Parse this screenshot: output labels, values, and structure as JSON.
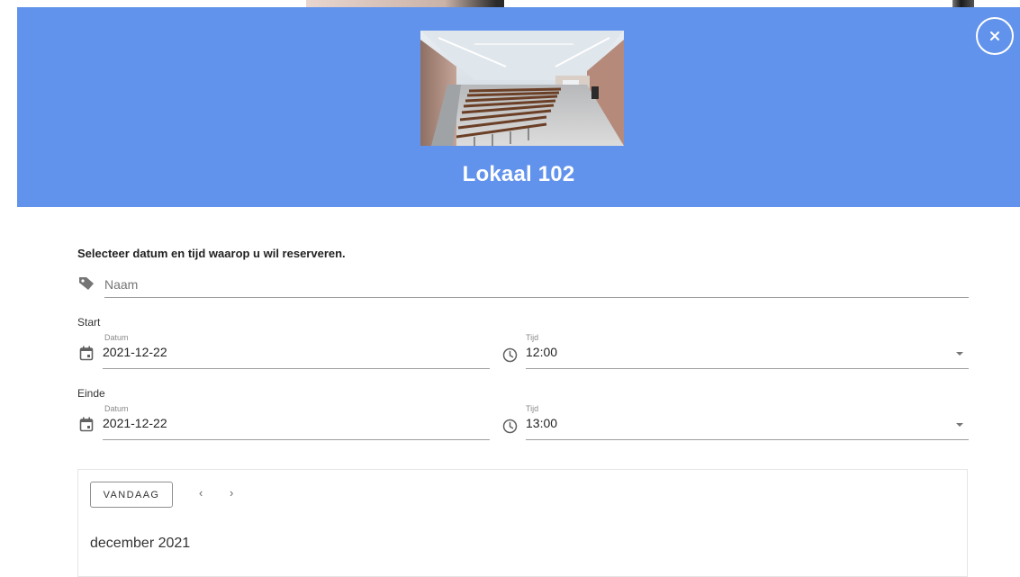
{
  "dialog": {
    "title": "Lokaal 102",
    "close_icon": "close-icon",
    "photo_icon": "lecture-hall-photo"
  },
  "form": {
    "instruction": "Selecteer datum en tijd waarop u wil reserveren.",
    "name": {
      "placeholder": "Naam",
      "value": "",
      "icon": "tag-icon"
    },
    "start": {
      "label": "Start",
      "date": {
        "label": "Datum",
        "value": "2021-12-22",
        "icon": "calendar-icon"
      },
      "time": {
        "label": "Tijd",
        "value": "12:00",
        "icon": "clock-icon"
      }
    },
    "end": {
      "label": "Einde",
      "date": {
        "label": "Datum",
        "value": "2021-12-22",
        "icon": "calendar-icon"
      },
      "time": {
        "label": "Tijd",
        "value": "13:00",
        "icon": "clock-icon"
      }
    }
  },
  "calendar": {
    "today_label": "VANDAAG",
    "prev_label": "‹",
    "next_label": "›",
    "month_label": "december 2021"
  },
  "colors": {
    "header_bg": "#6293ec",
    "header_text": "#ffffff"
  }
}
